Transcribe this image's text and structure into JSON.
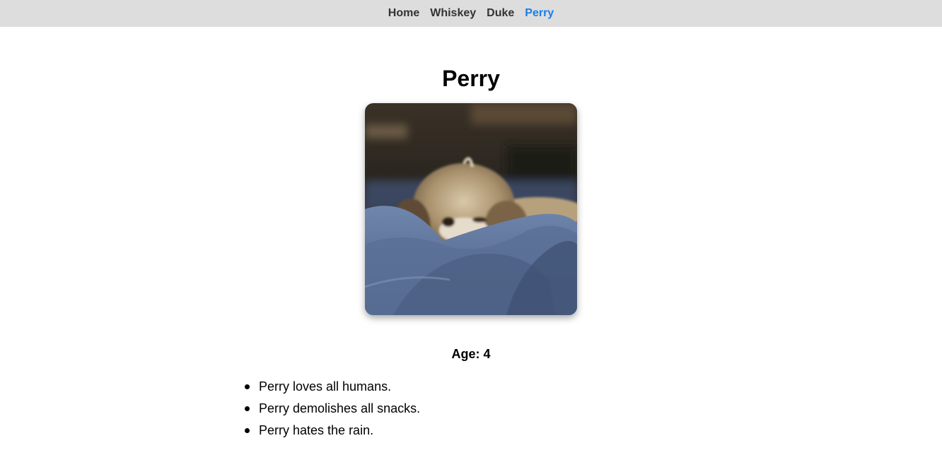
{
  "nav": {
    "items": [
      {
        "label": "Home",
        "active": false
      },
      {
        "label": "Whiskey",
        "active": false
      },
      {
        "label": "Duke",
        "active": false
      },
      {
        "label": "Perry",
        "active": true
      }
    ],
    "active_color": "#1a7ee8",
    "background": "#dddddd"
  },
  "main": {
    "title": "Perry",
    "photo_subject": "sleeping-dog-photo",
    "age_text": "Age: 4",
    "traits": [
      "Perry loves all humans.",
      "Perry demolishes all snacks.",
      "Perry hates the rain."
    ]
  }
}
